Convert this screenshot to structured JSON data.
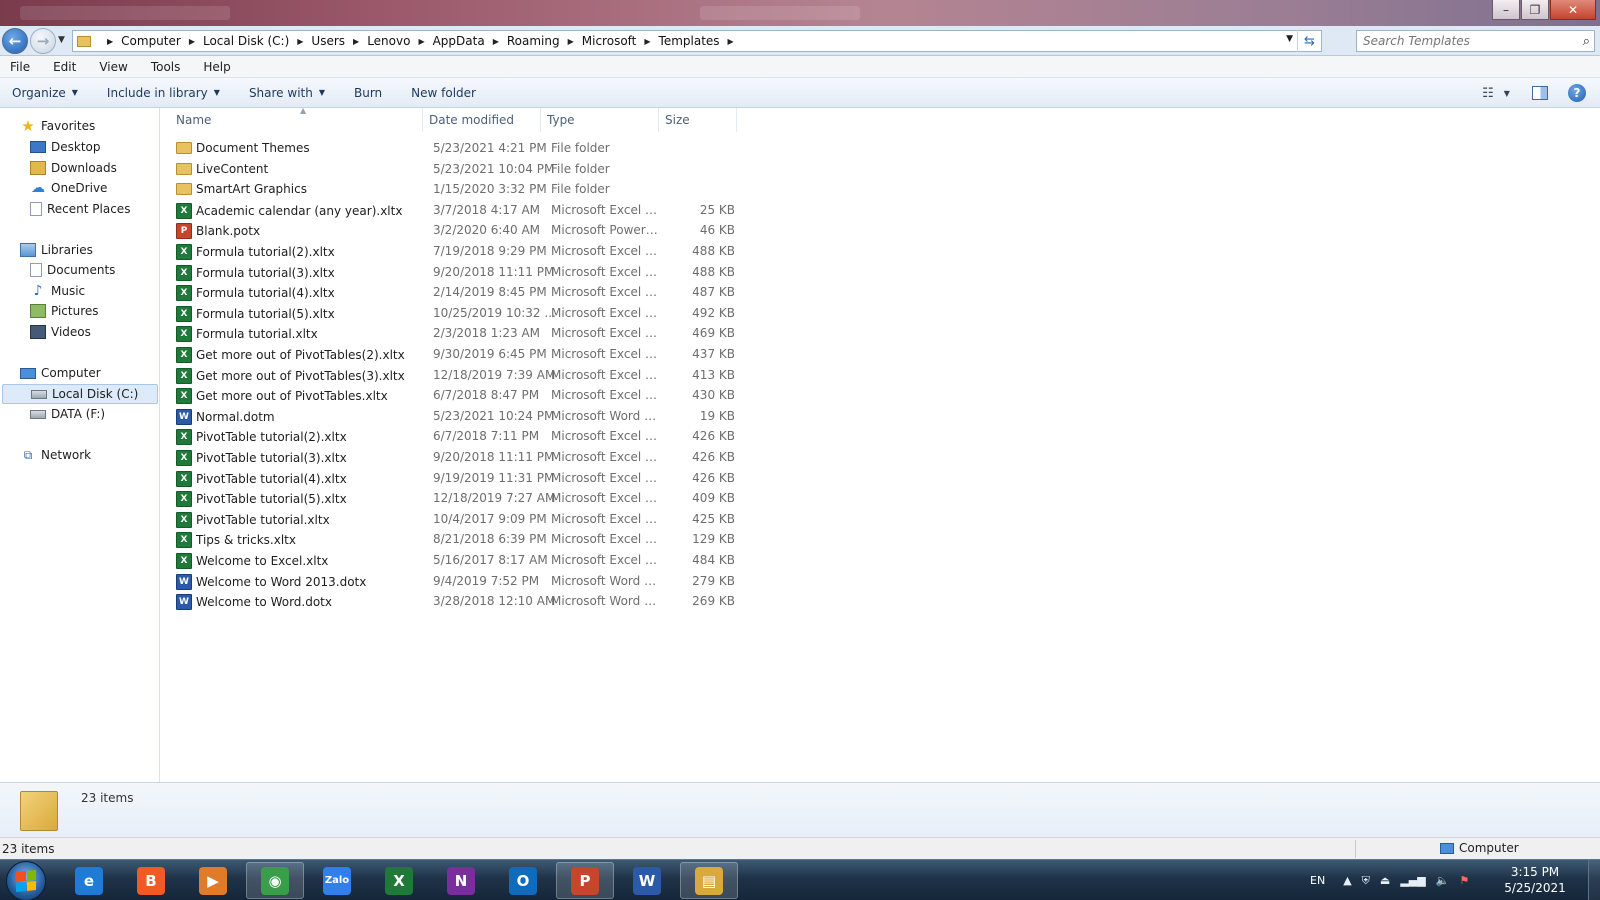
{
  "address": {
    "crumbs": [
      "Computer",
      "Local Disk (C:)",
      "Users",
      "Lenovo",
      "AppData",
      "Roaming",
      "Microsoft",
      "Templates"
    ]
  },
  "search": {
    "placeholder": "Search Templates"
  },
  "menu": [
    "File",
    "Edit",
    "View",
    "Tools",
    "Help"
  ],
  "toolbar": {
    "organize": "Organize",
    "include_library": "Include in library",
    "share_with": "Share with",
    "burn": "Burn",
    "new_folder": "New folder"
  },
  "nav": {
    "favorites": {
      "label": "Favorites",
      "items": [
        {
          "label": "Desktop",
          "icon": "desktop-icon"
        },
        {
          "label": "Downloads",
          "icon": "downloads-icon"
        },
        {
          "label": "OneDrive",
          "icon": "onedrive-icon"
        },
        {
          "label": "Recent Places",
          "icon": "recent-places-icon"
        }
      ]
    },
    "libraries": {
      "label": "Libraries",
      "items": [
        {
          "label": "Documents",
          "icon": "documents-icon"
        },
        {
          "label": "Music",
          "icon": "music-icon"
        },
        {
          "label": "Pictures",
          "icon": "pictures-icon"
        },
        {
          "label": "Videos",
          "icon": "videos-icon"
        }
      ]
    },
    "computer": {
      "label": "Computer",
      "items": [
        {
          "label": "Local Disk (C:)",
          "icon": "drive-icon",
          "selected": true
        },
        {
          "label": "DATA (F:)",
          "icon": "drive-icon"
        }
      ]
    },
    "network": {
      "label": "Network"
    }
  },
  "columns": {
    "name": "Name",
    "date": "Date modified",
    "type": "Type",
    "size": "Size"
  },
  "files": [
    {
      "name": "Document Themes",
      "date": "5/23/2021 4:21 PM",
      "type": "File folder",
      "size": "",
      "kind": "folder"
    },
    {
      "name": "LiveContent",
      "date": "5/23/2021 10:04 PM",
      "type": "File folder",
      "size": "",
      "kind": "folder"
    },
    {
      "name": "SmartArt Graphics",
      "date": "1/15/2020 3:32 PM",
      "type": "File folder",
      "size": "",
      "kind": "folder"
    },
    {
      "name": "Academic calendar (any year).xltx",
      "date": "3/7/2018 4:17 AM",
      "type": "Microsoft Excel Te...",
      "size": "25 KB",
      "kind": "excel"
    },
    {
      "name": "Blank.potx",
      "date": "3/2/2020 6:40 AM",
      "type": "Microsoft PowerP...",
      "size": "46 KB",
      "kind": "ppt"
    },
    {
      "name": "Formula tutorial(2).xltx",
      "date": "7/19/2018 9:29 PM",
      "type": "Microsoft Excel Te...",
      "size": "488 KB",
      "kind": "excel"
    },
    {
      "name": "Formula tutorial(3).xltx",
      "date": "9/20/2018 11:11 PM",
      "type": "Microsoft Excel Te...",
      "size": "488 KB",
      "kind": "excel"
    },
    {
      "name": "Formula tutorial(4).xltx",
      "date": "2/14/2019 8:45 PM",
      "type": "Microsoft Excel Te...",
      "size": "487 KB",
      "kind": "excel"
    },
    {
      "name": "Formula tutorial(5).xltx",
      "date": "10/25/2019 10:32 ...",
      "type": "Microsoft Excel Te...",
      "size": "492 KB",
      "kind": "excel"
    },
    {
      "name": "Formula tutorial.xltx",
      "date": "2/3/2018 1:23 AM",
      "type": "Microsoft Excel Te...",
      "size": "469 KB",
      "kind": "excel"
    },
    {
      "name": "Get more out of PivotTables(2).xltx",
      "date": "9/30/2019 6:45 PM",
      "type": "Microsoft Excel Te...",
      "size": "437 KB",
      "kind": "excel"
    },
    {
      "name": "Get more out of PivotTables(3).xltx",
      "date": "12/18/2019 7:39 AM",
      "type": "Microsoft Excel Te...",
      "size": "413 KB",
      "kind": "excel"
    },
    {
      "name": "Get more out of PivotTables.xltx",
      "date": "6/7/2018 8:47 PM",
      "type": "Microsoft Excel Te...",
      "size": "430 KB",
      "kind": "excel"
    },
    {
      "name": "Normal.dotm",
      "date": "5/23/2021 10:24 PM",
      "type": "Microsoft Word M...",
      "size": "19 KB",
      "kind": "word"
    },
    {
      "name": "PivotTable tutorial(2).xltx",
      "date": "6/7/2018 7:11 PM",
      "type": "Microsoft Excel Te...",
      "size": "426 KB",
      "kind": "excel"
    },
    {
      "name": "PivotTable tutorial(3).xltx",
      "date": "9/20/2018 11:11 PM",
      "type": "Microsoft Excel Te...",
      "size": "426 KB",
      "kind": "excel"
    },
    {
      "name": "PivotTable tutorial(4).xltx",
      "date": "9/19/2019 11:31 PM",
      "type": "Microsoft Excel Te...",
      "size": "426 KB",
      "kind": "excel"
    },
    {
      "name": "PivotTable tutorial(5).xltx",
      "date": "12/18/2019 7:27 AM",
      "type": "Microsoft Excel Te...",
      "size": "409 KB",
      "kind": "excel"
    },
    {
      "name": "PivotTable tutorial.xltx",
      "date": "10/4/2017 9:09 PM",
      "type": "Microsoft Excel Te...",
      "size": "425 KB",
      "kind": "excel"
    },
    {
      "name": "Tips & tricks.xltx",
      "date": "8/21/2018 6:39 PM",
      "type": "Microsoft Excel Te...",
      "size": "129 KB",
      "kind": "excel"
    },
    {
      "name": "Welcome to Excel.xltx",
      "date": "5/16/2017 8:17 AM",
      "type": "Microsoft Excel Te...",
      "size": "484 KB",
      "kind": "excel"
    },
    {
      "name": "Welcome to Word 2013.dotx",
      "date": "9/4/2019 7:52 PM",
      "type": "Microsoft Word T...",
      "size": "279 KB",
      "kind": "word"
    },
    {
      "name": "Welcome to Word.dotx",
      "date": "3/28/2018 12:10 AM",
      "type": "Microsoft Word T...",
      "size": "269 KB",
      "kind": "word"
    }
  ],
  "details": {
    "count": "23 items"
  },
  "status": {
    "count": "23 items",
    "location": "Computer"
  },
  "taskbar": {
    "apps": [
      {
        "name": "internet-explorer",
        "glyph": "e",
        "color": "#1e7bd6"
      },
      {
        "name": "brave",
        "glyph": "B",
        "color": "#f15a24"
      },
      {
        "name": "media-player",
        "glyph": "▶",
        "color": "#e07b2a"
      },
      {
        "name": "chrome",
        "glyph": "◉",
        "color": "#3a9d4a",
        "active": true
      },
      {
        "name": "zalo",
        "glyph": "Zalo",
        "color": "#2f80ed"
      },
      {
        "name": "excel",
        "glyph": "X",
        "color": "#1f7a3a"
      },
      {
        "name": "onenote",
        "glyph": "N",
        "color": "#7a2e9e"
      },
      {
        "name": "outlook",
        "glyph": "O",
        "color": "#0f6cbd"
      },
      {
        "name": "powerpoint",
        "glyph": "P",
        "color": "#c5462a",
        "active": true
      },
      {
        "name": "word",
        "glyph": "W",
        "color": "#2b5ba8"
      },
      {
        "name": "file-explorer",
        "glyph": "▤",
        "color": "#d9a93c",
        "active": true
      }
    ],
    "language": "EN",
    "time": "3:15 PM",
    "date": "5/25/2021"
  },
  "colors": {
    "accent": "#1e395b",
    "selection": "#dceaf9",
    "excel": "#1f7a3a",
    "word": "#2b5ba8",
    "powerpoint": "#c5462a",
    "folder": "#e8c25e"
  }
}
